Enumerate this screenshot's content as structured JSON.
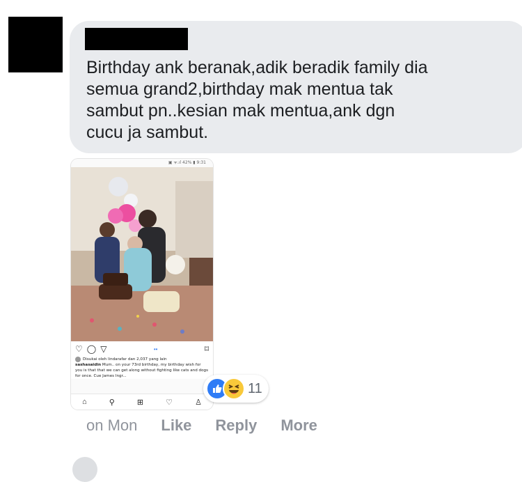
{
  "comment": {
    "text": "Birthday ank beranak,adik beradik family dia\nsemua grand2,birthday mak mentua tak\nsambut pn..kesian mak mentua,ank dgn\ncucu ja sambut."
  },
  "attachment": {
    "status_bar": "▣ ᯤ.ıl 42% ▮ 9:31",
    "ig_likes": "Disukai oleh lindarafar dan 2,037 yang lain",
    "ig_caption_user": "sashasaidin",
    "ig_caption": "Mum.. on your 73rd birthday, my birthday wish for you is that that we can get along without fighting like cats and dogs for once. Cue James Ingr..."
  },
  "reactions": {
    "count": "11",
    "icons": [
      "like-icon",
      "haha-icon"
    ]
  },
  "actions": {
    "time": "on Mon",
    "like": "Like",
    "reply": "Reply",
    "more": "More"
  },
  "colors": {
    "bubble": "#e9ebee",
    "like_blue": "#2f7cf6",
    "meta_gray": "#90949c"
  }
}
